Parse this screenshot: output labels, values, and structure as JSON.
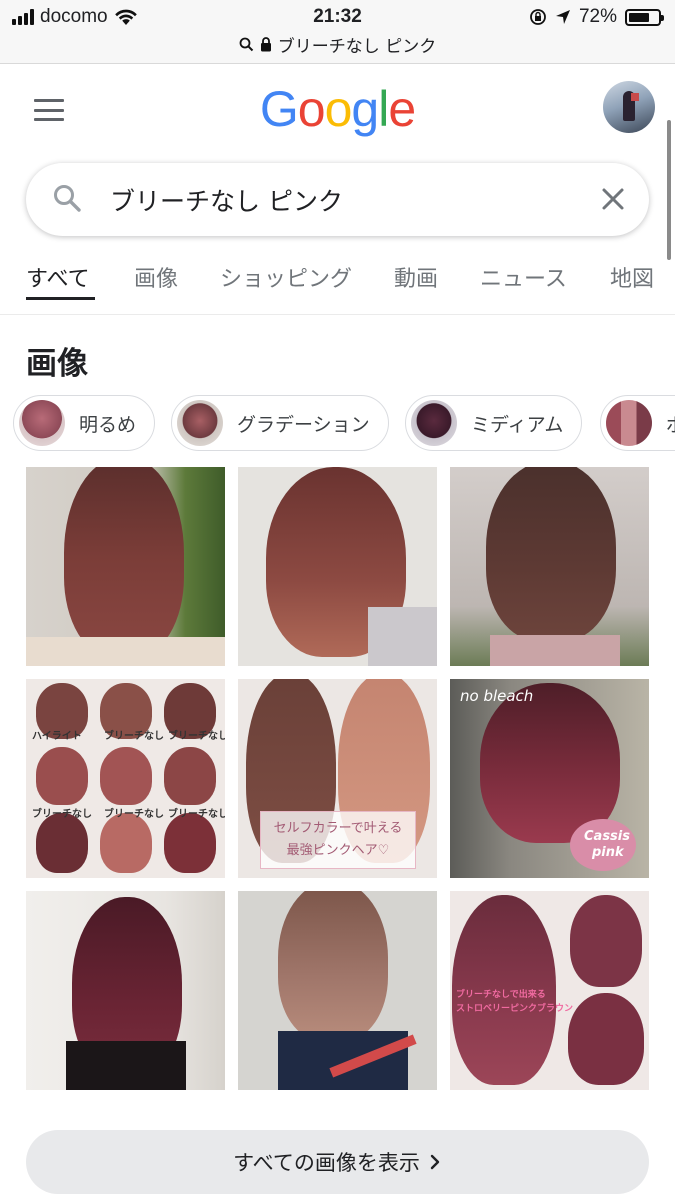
{
  "status_bar": {
    "carrier": "docomo",
    "time": "21:32",
    "battery": "72%",
    "battery_level": 0.72
  },
  "url_bar": {
    "text": "ブリーチなし ピンク"
  },
  "header": {
    "logo_letters": [
      "G",
      "o",
      "o",
      "g",
      "l",
      "e"
    ],
    "logo_colors": [
      "#4285F4",
      "#EA4335",
      "#FBBC05",
      "#4285F4",
      "#34A853",
      "#EA4335"
    ]
  },
  "search": {
    "query": "ブリーチなし ピンク"
  },
  "tabs": [
    {
      "label": "すべて",
      "active": true
    },
    {
      "label": "画像",
      "active": false
    },
    {
      "label": "ショッピング",
      "active": false
    },
    {
      "label": "動画",
      "active": false
    },
    {
      "label": "ニュース",
      "active": false
    },
    {
      "label": "地図",
      "active": false
    }
  ],
  "images_section": {
    "title": "画像",
    "chips": [
      {
        "label": "明るめ"
      },
      {
        "label": "グラデーション"
      },
      {
        "label": "ミディアム"
      },
      {
        "label": "ボ"
      }
    ],
    "tile_texts": {
      "tile4": [
        "ハイライト",
        "ブリーチなし",
        "ブリーチなし",
        "ブリーチなし",
        "ブリーチなし",
        "ブリーチなし"
      ],
      "tile5_lines": [
        "セルフカラーで叶える",
        "最強ピンクヘア♡"
      ],
      "tile6": [
        "no bleach",
        "Cassis",
        "pink"
      ],
      "tile9": [
        "ブリーチなしで出来る",
        "ストロベリーピンクブラウン"
      ]
    },
    "more_label": "すべての画像を表示"
  }
}
